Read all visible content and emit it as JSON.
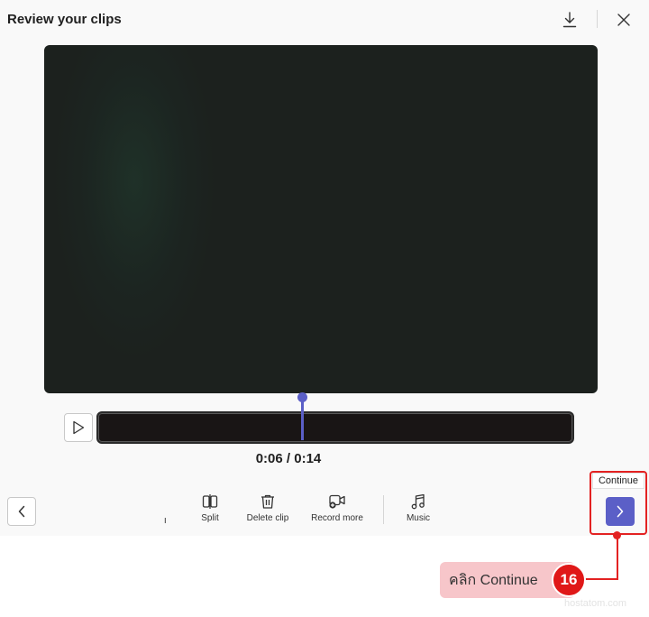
{
  "dialog": {
    "title": "Review your clips"
  },
  "icons": {
    "download": "download-icon",
    "close": "close-icon",
    "play": "play-icon",
    "back": "chevron-left-icon",
    "next": "chevron-right-icon"
  },
  "player": {
    "time_display": "0:06 / 0:14",
    "progress": 0.43
  },
  "toolbar": {
    "partial_label": "ו",
    "tools": [
      {
        "label": "Split",
        "icon": "split-icon"
      },
      {
        "label": "Delete clip",
        "icon": "trash-icon"
      },
      {
        "label": "Record more",
        "icon": "add-video-icon"
      },
      {
        "label": "Music",
        "icon": "music-note-icon"
      }
    ]
  },
  "continue": {
    "tooltip": "Continue"
  },
  "annotation": {
    "text": "คลิก Continue",
    "step": "16"
  },
  "watermark": "hostatom.com",
  "colors": {
    "accent": "#5b5fc7",
    "annotation_red": "#e32222",
    "callout_bg": "#f7c6ca"
  }
}
